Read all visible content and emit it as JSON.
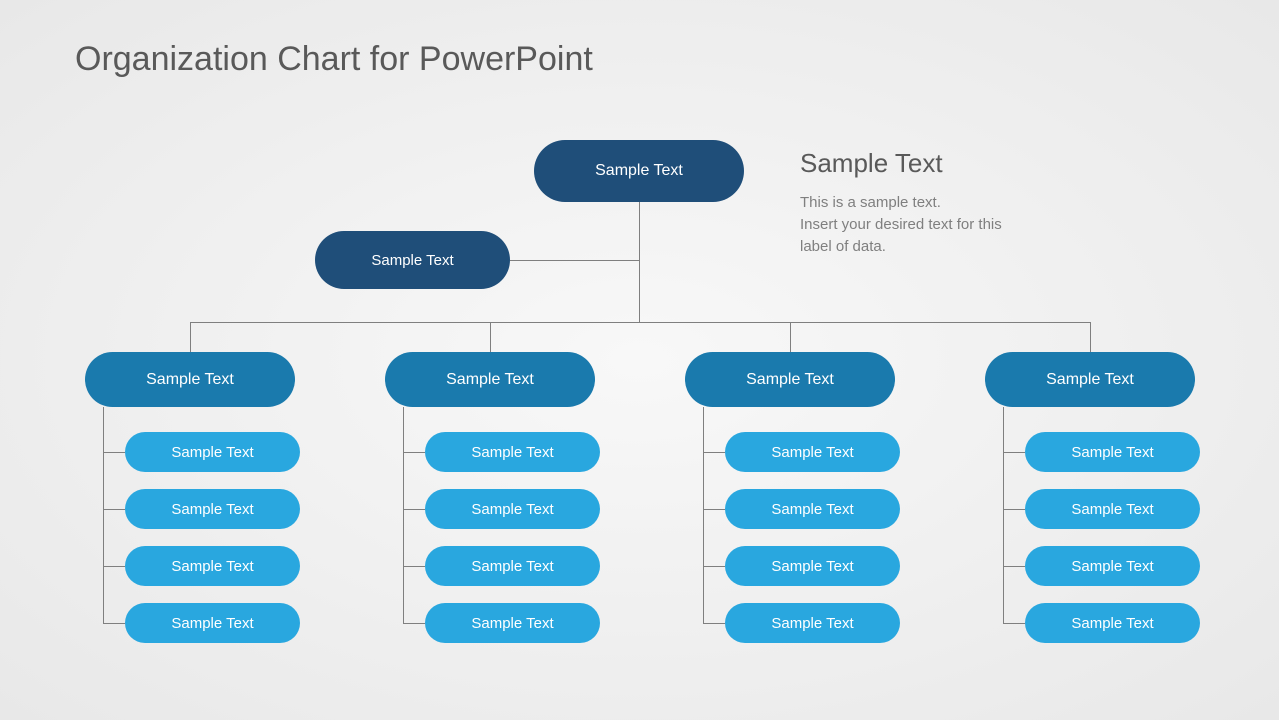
{
  "title": "Organization Chart for PowerPoint",
  "description": {
    "heading": "Sample Text",
    "body": "This is a sample text.\nInsert your desired text for this\nlabel of data."
  },
  "org": {
    "root": "Sample Text",
    "assistant": "Sample Text",
    "branches": [
      {
        "head": "Sample Text",
        "children": [
          "Sample Text",
          "Sample Text",
          "Sample Text",
          "Sample Text"
        ]
      },
      {
        "head": "Sample Text",
        "children": [
          "Sample Text",
          "Sample Text",
          "Sample Text",
          "Sample Text"
        ]
      },
      {
        "head": "Sample Text",
        "children": [
          "Sample Text",
          "Sample Text",
          "Sample Text",
          "Sample Text"
        ]
      },
      {
        "head": "Sample Text",
        "children": [
          "Sample Text",
          "Sample Text",
          "Sample Text",
          "Sample Text"
        ]
      }
    ]
  },
  "colors": {
    "dark": "#1f4e79",
    "mid": "#1a7aad",
    "light": "#29a7df"
  }
}
